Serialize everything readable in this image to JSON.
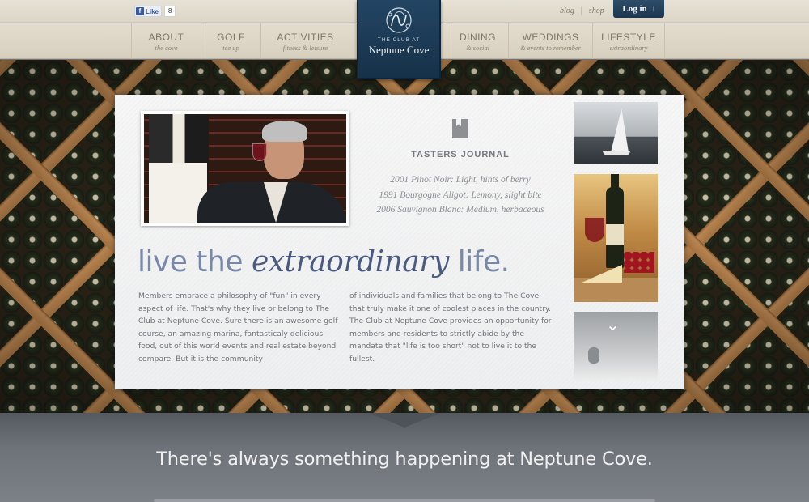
{
  "topbar": {
    "facebook": {
      "like_label": "Like",
      "count": "8"
    },
    "links": [
      "blog",
      "shop"
    ],
    "login_label": "Log in"
  },
  "logo": {
    "small": "THE CLUB AT",
    "big": "Neptune Cove"
  },
  "nav": [
    {
      "title": "ABOUT",
      "sub": "the cove"
    },
    {
      "title": "GOLF",
      "sub": "tee up"
    },
    {
      "title": "ACTIVITIES",
      "sub": "fitness & leisure"
    },
    {
      "title": "DINING",
      "sub": "& social"
    },
    {
      "title": "WEDDINGS",
      "sub": "& events to remember"
    },
    {
      "title": "LIFESTYLE",
      "sub": "extraordinary"
    }
  ],
  "journal": {
    "icon": "book-icon",
    "title": "TASTERS JOURNAL",
    "entries": [
      "2001 Pinot Noir: Light, hints of berry",
      "1991 Bourgogne Aligot: Lemony, slight bite",
      "2006 Sauvignon Blanc: Medium, herbaceous"
    ]
  },
  "tagline": {
    "pre": "live the ",
    "em": "extraordinary",
    "post": " life."
  },
  "body": {
    "col1": "Members embrace a philosophy of \"fun\" in every aspect of life. That's why they live or belong to The Club at Neptune Cove. Sure there is an awesome golf course, an amazing marina, fantasticaly delicious food, out of this world events and real estate beyond compare. But it is the community",
    "col2": "of individuals and families that belong to The Cove that truly make it one of coolest places in the country. The Club at Neptune Cove provides an opportunity for members and residents to strictly abide by the mandate that \"life is too short\" not to live it to the fullest."
  },
  "footer_banner": "There's always something happening at Neptune Cove.",
  "colors": {
    "brand_navy": "#1c3650",
    "tagline_accent": "#4b5a80"
  }
}
